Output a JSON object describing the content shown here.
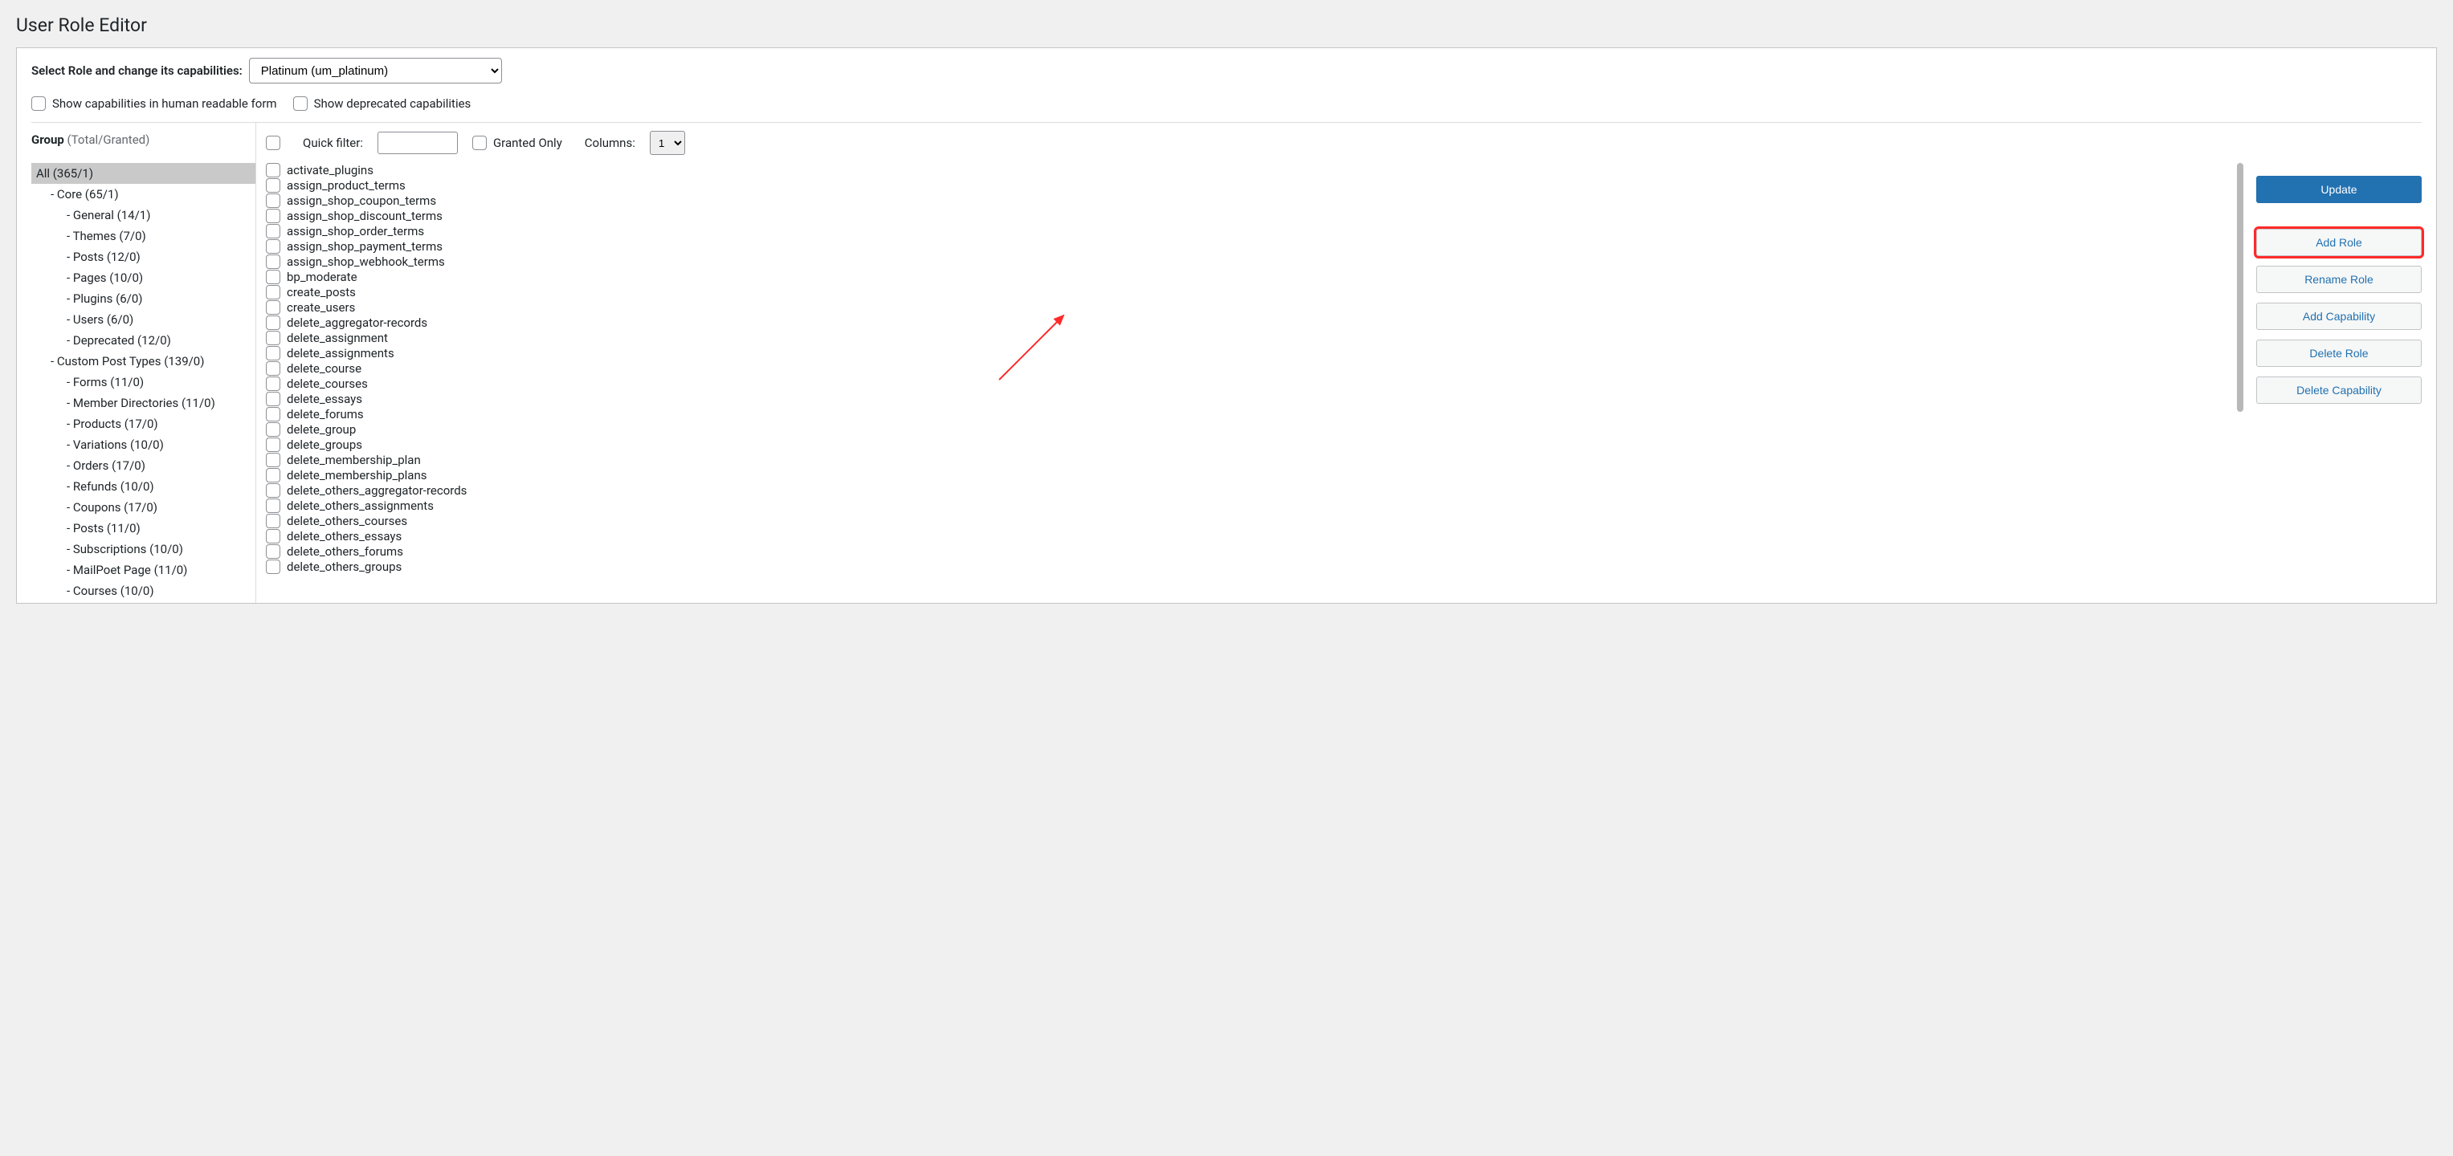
{
  "page_title": "User Role Editor",
  "select_role_label": "Select Role and change its capabilities:",
  "role_select_value": "Platinum (um_platinum)",
  "check_human_readable": "Show capabilities in human readable form",
  "check_deprecated": "Show deprecated capabilities",
  "group_header": "Group",
  "group_header_meta": " (Total/Granted)",
  "groups": [
    {
      "label": "All (365/1)",
      "indent": 0,
      "selected": true
    },
    {
      "label": "Core (65/1)",
      "indent": 1
    },
    {
      "label": "General (14/1)",
      "indent": 2
    },
    {
      "label": "Themes (7/0)",
      "indent": 2
    },
    {
      "label": "Posts (12/0)",
      "indent": 2
    },
    {
      "label": "Pages (10/0)",
      "indent": 2
    },
    {
      "label": "Plugins (6/0)",
      "indent": 2
    },
    {
      "label": "Users (6/0)",
      "indent": 2
    },
    {
      "label": "Deprecated (12/0)",
      "indent": 2
    },
    {
      "label": "Custom Post Types (139/0)",
      "indent": 1
    },
    {
      "label": "Forms (11/0)",
      "indent": 2
    },
    {
      "label": "Member Directories (11/0)",
      "indent": 2
    },
    {
      "label": "Products (17/0)",
      "indent": 2
    },
    {
      "label": "Variations (10/0)",
      "indent": 2
    },
    {
      "label": "Orders (17/0)",
      "indent": 2
    },
    {
      "label": "Refunds (10/0)",
      "indent": 2
    },
    {
      "label": "Coupons (17/0)",
      "indent": 2
    },
    {
      "label": "Posts (11/0)",
      "indent": 2
    },
    {
      "label": "Subscriptions (10/0)",
      "indent": 2
    },
    {
      "label": "MailPoet Page (11/0)",
      "indent": 2
    },
    {
      "label": "Courses (10/0)",
      "indent": 2
    }
  ],
  "quick_filter_label": "Quick filter:",
  "granted_only_label": "Granted Only",
  "columns_label": "Columns:",
  "columns_value": "1",
  "capabilities": [
    "activate_plugins",
    "assign_product_terms",
    "assign_shop_coupon_terms",
    "assign_shop_discount_terms",
    "assign_shop_order_terms",
    "assign_shop_payment_terms",
    "assign_shop_webhook_terms",
    "bp_moderate",
    "create_posts",
    "create_users",
    "delete_aggregator-records",
    "delete_assignment",
    "delete_assignments",
    "delete_course",
    "delete_courses",
    "delete_essays",
    "delete_forums",
    "delete_group",
    "delete_groups",
    "delete_membership_plan",
    "delete_membership_plans",
    "delete_others_aggregator-records",
    "delete_others_assignments",
    "delete_others_courses",
    "delete_others_essays",
    "delete_others_forums",
    "delete_others_groups"
  ],
  "actions": {
    "update": "Update",
    "add_role": "Add Role",
    "rename_role": "Rename Role",
    "add_capability": "Add Capability",
    "delete_role": "Delete Role",
    "delete_capability": "Delete Capability"
  }
}
